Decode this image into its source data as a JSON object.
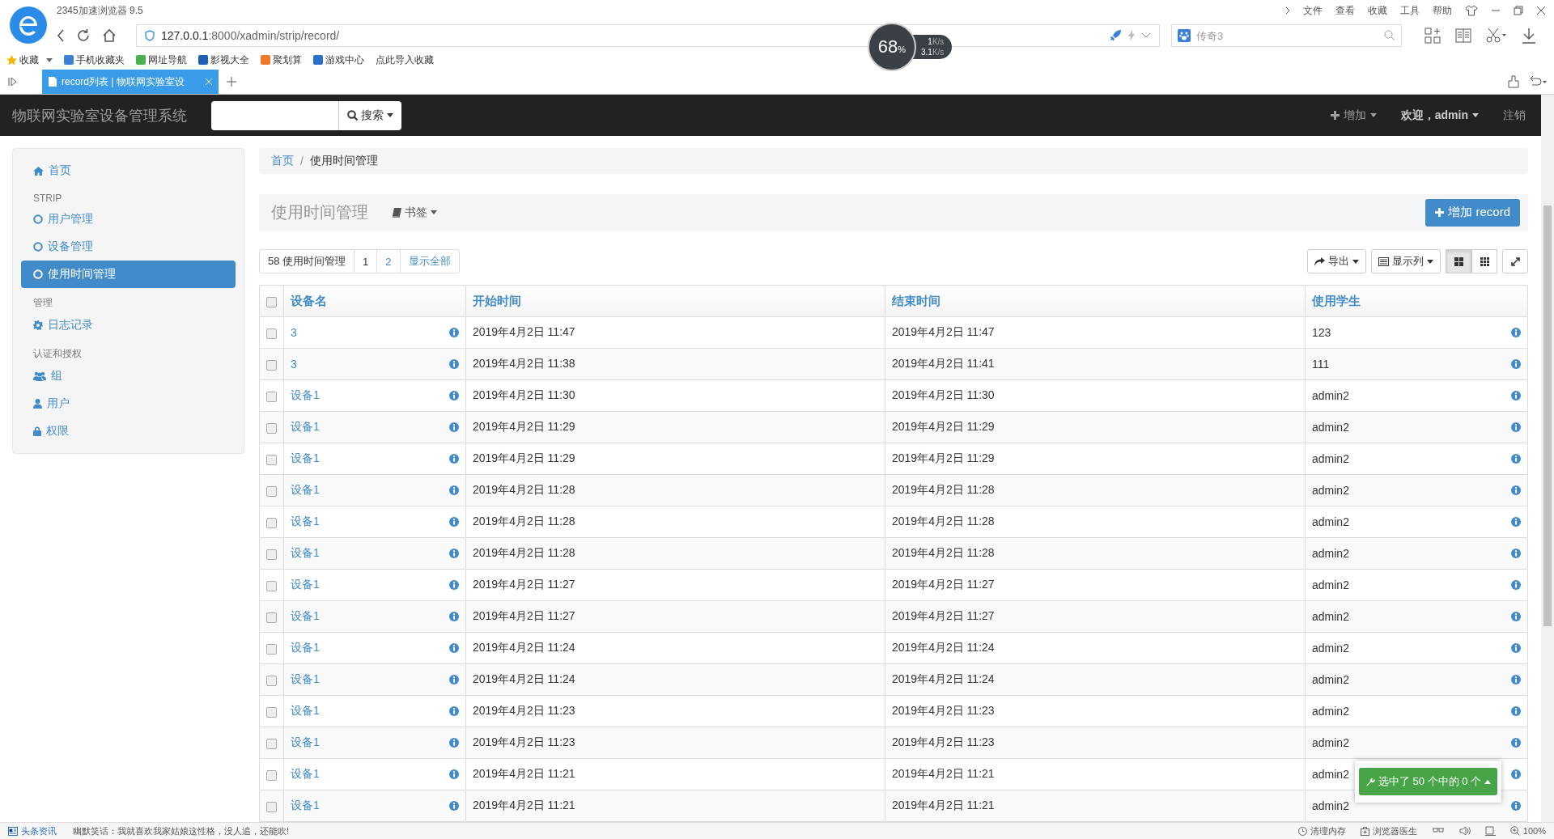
{
  "browser": {
    "title": "2345加速浏览器 9.5",
    "menu": [
      "文件",
      "查看",
      "收藏",
      "工具",
      "帮助"
    ],
    "url_host": "127.0.0.1",
    "url_path": ":8000/xadmin/strip/record/",
    "search_placeholder": "传奇3",
    "bookmarks": [
      "收藏",
      "手机收藏夹",
      "网址导航",
      "影视大全",
      "聚划算",
      "游戏中心",
      "点此导入收藏"
    ],
    "tab_title": "record列表 | 物联网实验室设",
    "speed": {
      "percent": "68",
      "percent_unit": "%",
      "upload": "1",
      "upload_unit": "K/s",
      "download": "3.1",
      "download_unit": "K/s"
    }
  },
  "navbar": {
    "brand": "物联网实验室设备管理系统",
    "search_button": "搜索",
    "items": [
      {
        "kind": "add",
        "label": "增加"
      },
      {
        "kind": "user",
        "label": "欢迎，admin"
      },
      {
        "kind": "plain",
        "label": "注销"
      }
    ]
  },
  "sidebar": {
    "items": [
      {
        "kind": "link",
        "label": "首页",
        "selected": false
      },
      {
        "kind": "header",
        "label": "STRIP"
      },
      {
        "kind": "link",
        "label": "用户管理",
        "selected": false
      },
      {
        "kind": "link",
        "label": "设备管理",
        "selected": false
      },
      {
        "kind": "link",
        "label": "使用时间管理",
        "selected": true
      },
      {
        "kind": "header",
        "label": "管理"
      },
      {
        "kind": "link",
        "label": "日志记录",
        "selected": false
      },
      {
        "kind": "header",
        "label": "认证和授权"
      },
      {
        "kind": "link",
        "label": "组",
        "selected": false
      },
      {
        "kind": "link",
        "label": "用户",
        "selected": false
      },
      {
        "kind": "link",
        "label": "权限",
        "selected": false
      }
    ]
  },
  "breadcrumb": [
    "首页",
    "使用时间管理"
  ],
  "breadcrumb_separator": "/",
  "page_header": {
    "title": "使用时间管理",
    "bookmark_button": "书签",
    "add_button": "增加 record"
  },
  "toolbar": {
    "count": "58 使用时间管理",
    "pages": [
      {
        "label": "1",
        "selected": true
      },
      {
        "label": "2",
        "selected": false
      }
    ],
    "show_all": "显示全部",
    "export_button": "导出",
    "columns_button": "显示列",
    "view_modes": [
      {
        "selected": true
      },
      {
        "selected": false
      }
    ]
  },
  "table": {
    "select_all_checked": false,
    "columns": [
      "设备名",
      "开始时间",
      "结束时间",
      "使用学生"
    ],
    "rows": [
      {
        "checked": false,
        "device": "3",
        "start": "2019年4月2日 11:47",
        "end": "2019年4月2日 11:47",
        "student": "123"
      },
      {
        "checked": false,
        "device": "3",
        "start": "2019年4月2日 11:38",
        "end": "2019年4月2日 11:41",
        "student": "111"
      },
      {
        "checked": false,
        "device": "设备1",
        "start": "2019年4月2日 11:30",
        "end": "2019年4月2日 11:30",
        "student": "admin2"
      },
      {
        "checked": false,
        "device": "设备1",
        "start": "2019年4月2日 11:29",
        "end": "2019年4月2日 11:29",
        "student": "admin2"
      },
      {
        "checked": false,
        "device": "设备1",
        "start": "2019年4月2日 11:29",
        "end": "2019年4月2日 11:29",
        "student": "admin2"
      },
      {
        "checked": false,
        "device": "设备1",
        "start": "2019年4月2日 11:28",
        "end": "2019年4月2日 11:28",
        "student": "admin2"
      },
      {
        "checked": false,
        "device": "设备1",
        "start": "2019年4月2日 11:28",
        "end": "2019年4月2日 11:28",
        "student": "admin2"
      },
      {
        "checked": false,
        "device": "设备1",
        "start": "2019年4月2日 11:28",
        "end": "2019年4月2日 11:28",
        "student": "admin2"
      },
      {
        "checked": false,
        "device": "设备1",
        "start": "2019年4月2日 11:27",
        "end": "2019年4月2日 11:27",
        "student": "admin2"
      },
      {
        "checked": false,
        "device": "设备1",
        "start": "2019年4月2日 11:27",
        "end": "2019年4月2日 11:27",
        "student": "admin2"
      },
      {
        "checked": false,
        "device": "设备1",
        "start": "2019年4月2日 11:24",
        "end": "2019年4月2日 11:24",
        "student": "admin2"
      },
      {
        "checked": false,
        "device": "设备1",
        "start": "2019年4月2日 11:24",
        "end": "2019年4月2日 11:24",
        "student": "admin2"
      },
      {
        "checked": false,
        "device": "设备1",
        "start": "2019年4月2日 11:23",
        "end": "2019年4月2日 11:23",
        "student": "admin2"
      },
      {
        "checked": false,
        "device": "设备1",
        "start": "2019年4月2日 11:23",
        "end": "2019年4月2日 11:23",
        "student": "admin2"
      },
      {
        "checked": false,
        "device": "设备1",
        "start": "2019年4月2日 11:21",
        "end": "2019年4月2日 11:21",
        "student": "admin2"
      },
      {
        "checked": false,
        "device": "设备1",
        "start": "2019年4月2日 11:21",
        "end": "2019年4月2日 11:21",
        "student": "admin2"
      }
    ]
  },
  "selection_button": "选中了 50 个中的 0 个",
  "status_bar": {
    "news_label": "头条资讯",
    "news_text": "幽默笑话：我就喜欢我家姑娘这性格，没人追，还能吹!",
    "items": [
      "清理内存",
      "浏览器医生"
    ],
    "zoom": "100%"
  }
}
